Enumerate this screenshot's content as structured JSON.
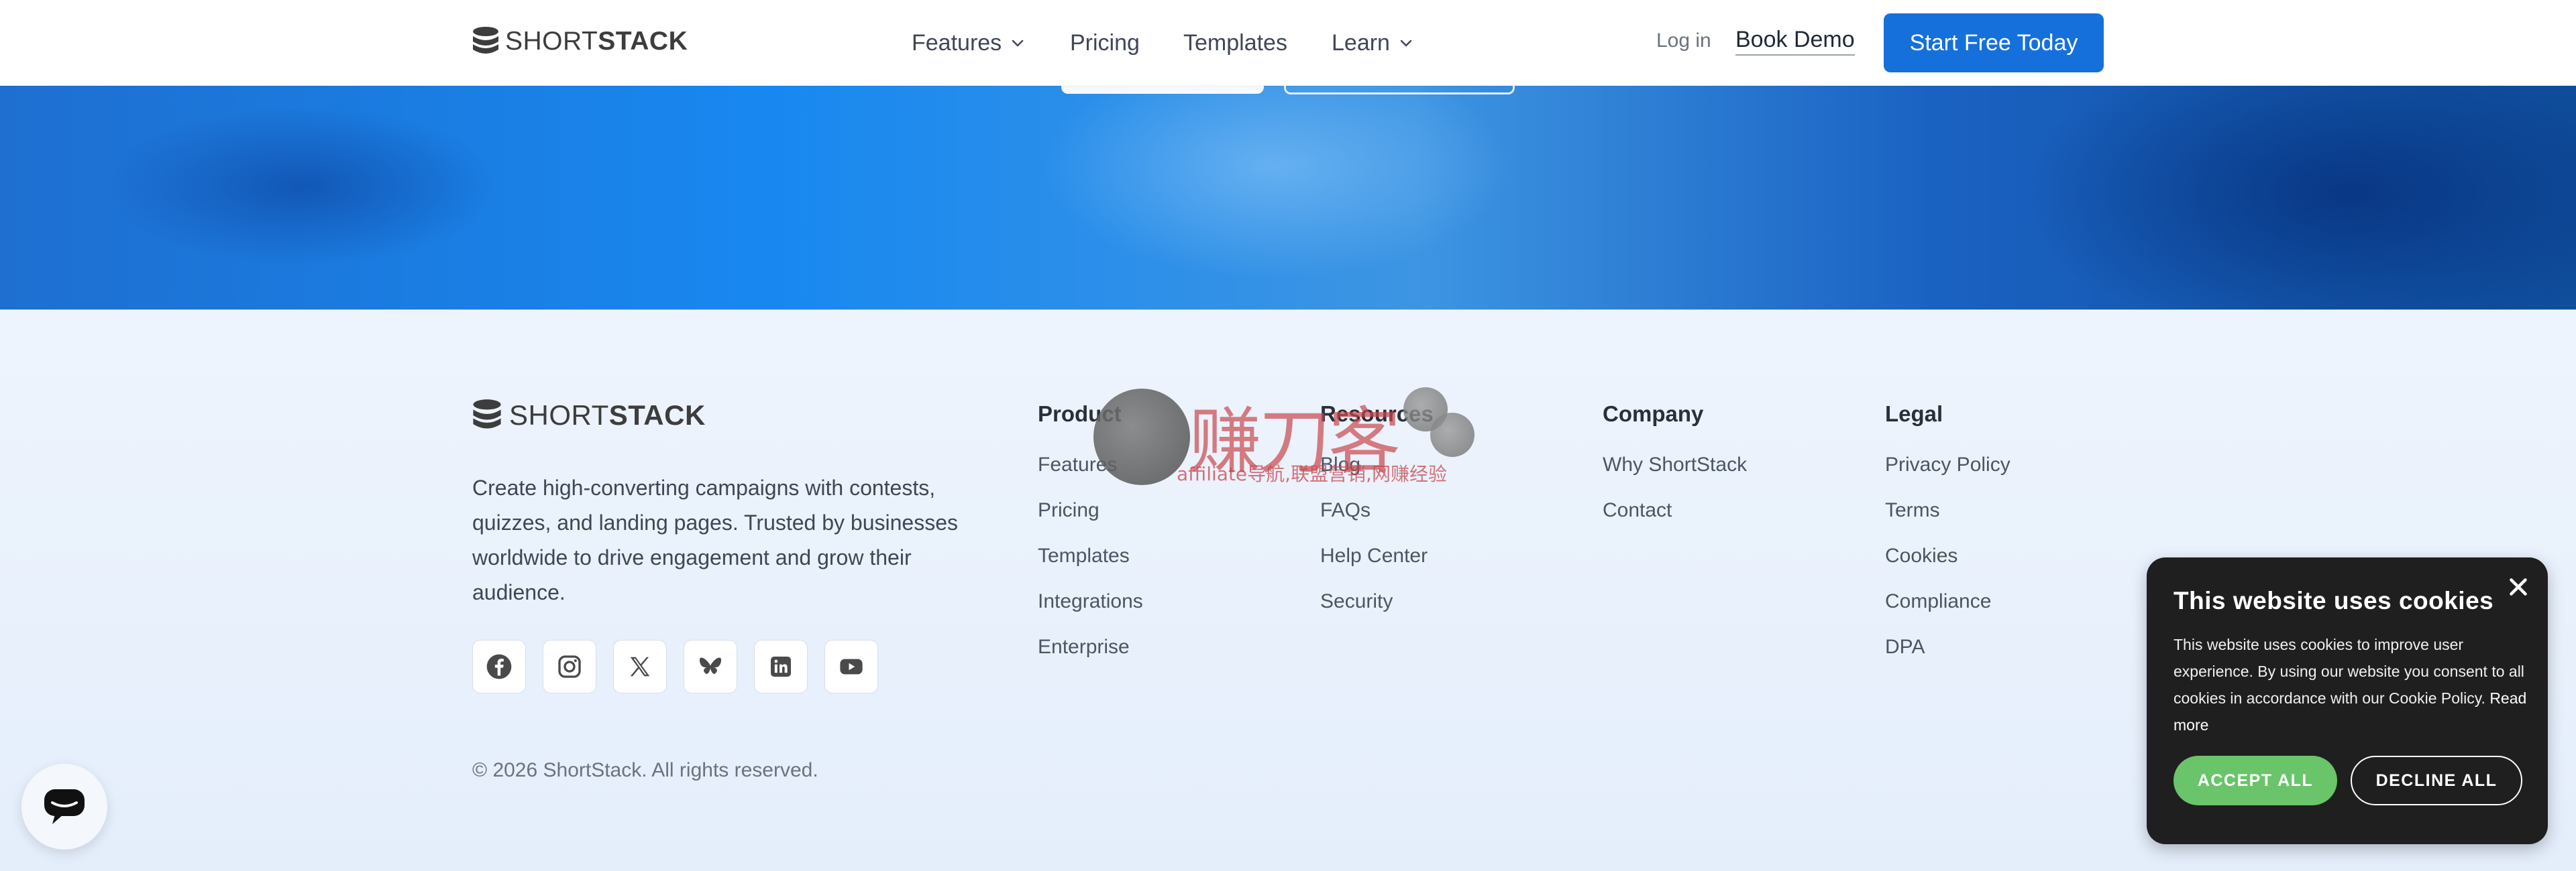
{
  "brand": {
    "name_light": "SHORT",
    "name_bold": "STACK"
  },
  "nav": {
    "items": [
      {
        "label": "Features",
        "has_dropdown": true
      },
      {
        "label": "Pricing",
        "has_dropdown": false
      },
      {
        "label": "Templates",
        "has_dropdown": false
      },
      {
        "label": "Learn",
        "has_dropdown": true
      }
    ],
    "login": "Log in",
    "book_demo": "Book Demo",
    "cta": "Start Free Today"
  },
  "colors": {
    "primary": "#1570dc",
    "accept": "#69c46a",
    "popup_bg": "#1f1f1f",
    "footer_bg": "#eef4fd"
  },
  "footer": {
    "tagline": "Create high-converting campaigns with contests, quizzes, and landing pages. Trusted by businesses worldwide to drive engagement and grow their audience.",
    "socials": [
      "facebook-icon",
      "instagram-icon",
      "x-icon",
      "bluesky-icon",
      "linkedin-icon",
      "youtube-icon"
    ],
    "copyright": "© 2026 ShortStack. All rights reserved.",
    "columns": [
      {
        "title": "Product",
        "links": [
          "Features",
          "Pricing",
          "Templates",
          "Integrations",
          "Enterprise"
        ]
      },
      {
        "title": "Resources",
        "links": [
          "Blog",
          "FAQs",
          "Help Center",
          "Security"
        ]
      },
      {
        "title": "Company",
        "links": [
          "Why ShortStack",
          "Contact"
        ]
      },
      {
        "title": "Legal",
        "links": [
          "Privacy Policy",
          "Terms",
          "Cookies",
          "Compliance",
          "DPA"
        ]
      }
    ]
  },
  "watermark": {
    "chinese": "赚刀客",
    "subtitle": "affiliate导航,联盟营销,网赚经验"
  },
  "cookie": {
    "title": "This website uses cookies",
    "body": "This website uses cookies to improve user experience. By using our website you consent to all cookies in accordance with our Cookie Policy.",
    "read_more": "Read more",
    "accept": "ACCEPT ALL",
    "decline": "DECLINE ALL"
  },
  "chat": {
    "icon": "chat-icon"
  }
}
